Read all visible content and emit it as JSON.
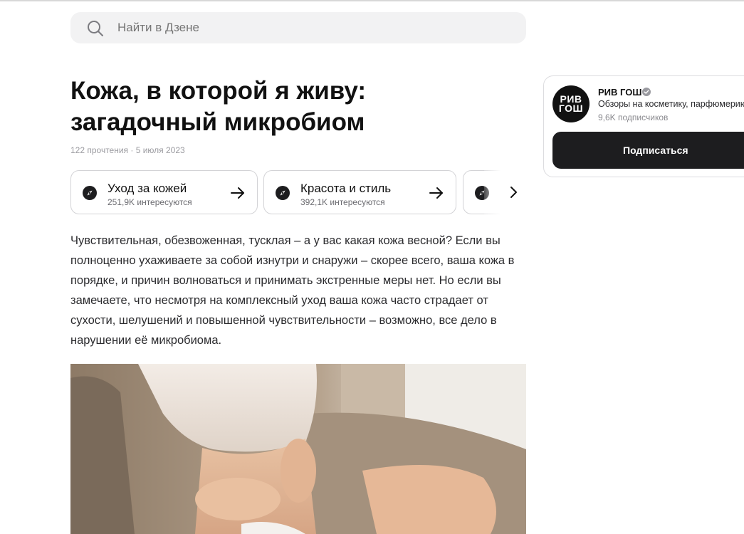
{
  "search": {
    "placeholder": "Найти в Дзене"
  },
  "article": {
    "title_line1": "Кожа, в которой я живу:",
    "title_line2": "загадочный микробиом",
    "meta": "122 прочтения · 5 июля 2023",
    "body": "Чувствительная, обезвоженная, тусклая – а у вас какая кожа весной? Если вы полноценно ухаживаете за собой изнутри и снаружи – скорее всего, ваша кожа в порядке, и причин волноваться и принимать экстренные меры нет. Но если вы замечаете, что несмотря на комплексный уход ваша кожа часто страдает от сухости, шелушений и повышенной чувствительности – возможно, все дело в нарушении её микробиома."
  },
  "tags": [
    {
      "label": "Уход за кожей",
      "sub": "251,9K интересуются",
      "icon": "compass-icon",
      "arrow": "arrow-right-icon"
    },
    {
      "label": "Красота и стиль",
      "sub": "392,1K интересуются",
      "icon": "compass-icon",
      "arrow": "arrow-right-icon"
    }
  ],
  "channel": {
    "avatar_line1": "РИВ",
    "avatar_line2": "ГОШ",
    "name": "РИВ ГОШ",
    "description": "Обзоры на косметику, парфюмерию",
    "subscribers": "9,6K подписчиков",
    "subscribe_label": "Подписаться"
  },
  "colors": {
    "search_bg": "#f2f2f3",
    "button_bg": "#1d1d1f",
    "text_primary": "#111111",
    "text_muted": "#9b9ba0"
  }
}
